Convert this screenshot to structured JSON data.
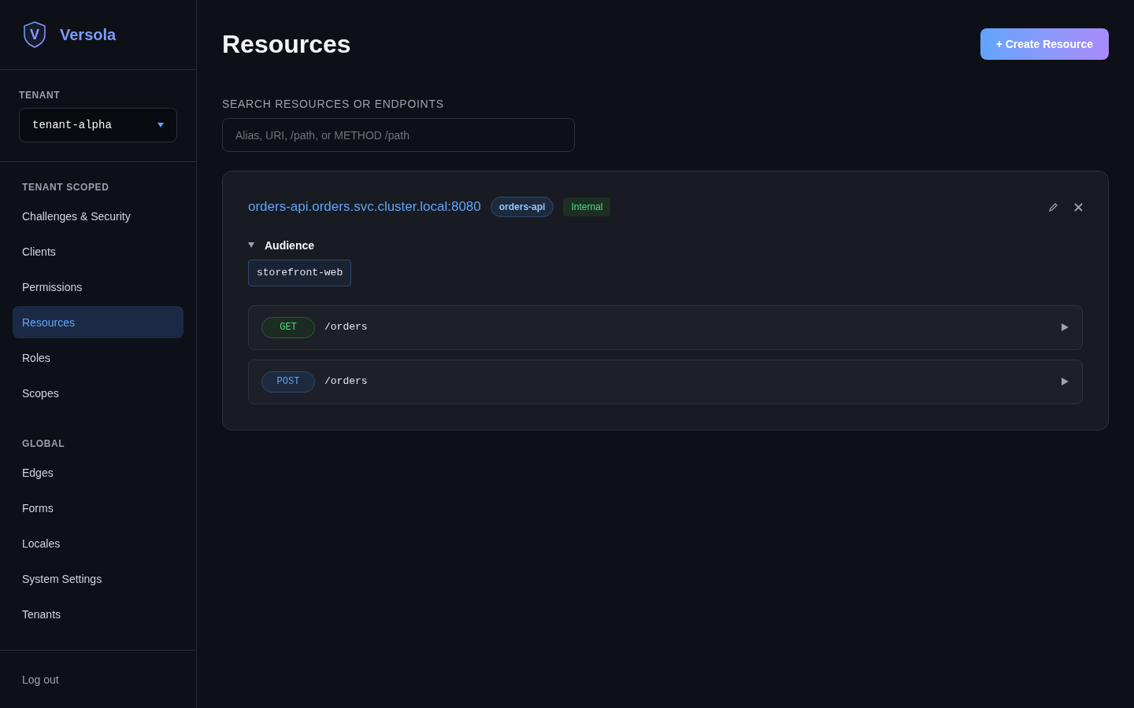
{
  "brand": {
    "logo_letter": "V",
    "name": "Versola"
  },
  "tenant": {
    "label": "TENANT",
    "value": "tenant-alpha"
  },
  "nav_sections": [
    {
      "title": "TENANT SCOPED",
      "items": [
        {
          "label": "Challenges & Security",
          "selected": false
        },
        {
          "label": "Clients",
          "selected": false
        },
        {
          "label": "Permissions",
          "selected": false
        },
        {
          "label": "Resources",
          "selected": true
        },
        {
          "label": "Roles",
          "selected": false
        },
        {
          "label": "Scopes",
          "selected": false
        }
      ]
    },
    {
      "title": "GLOBAL",
      "items": [
        {
          "label": "Edges",
          "selected": false
        },
        {
          "label": "Forms",
          "selected": false
        },
        {
          "label": "Locales",
          "selected": false
        },
        {
          "label": "System Settings",
          "selected": false
        },
        {
          "label": "Tenants",
          "selected": false
        }
      ]
    }
  ],
  "logout": "Log out",
  "page_title": "Resources",
  "create_button": "+ Create Resource",
  "search": {
    "label": "SEARCH RESOURCES OR ENDPOINTS",
    "placeholder": "Alias, URI, /path, or METHOD /path"
  },
  "resources": [
    {
      "uri": "orders-api.orders.svc.cluster.local:8080",
      "alias": "orders-api",
      "visibility": "Internal",
      "audience": {
        "title": "Audience",
        "expanded": true,
        "values": [
          "storefront-web"
        ]
      },
      "endpoints": [
        {
          "kind": "get",
          "method": "GET",
          "path": "/orders",
          "expanded": false
        },
        {
          "kind": "post",
          "method": "POST",
          "path": "/orders",
          "expanded": false
        }
      ]
    }
  ]
}
